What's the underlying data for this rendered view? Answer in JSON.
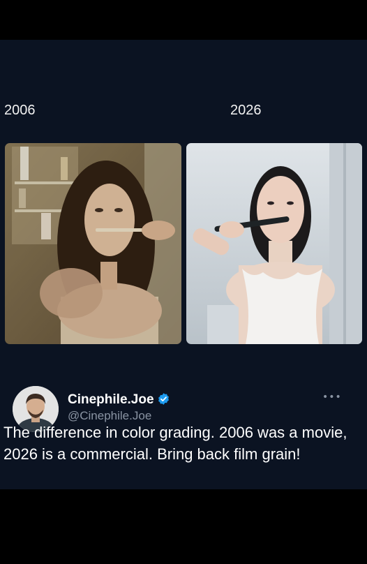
{
  "comparison": {
    "left_label": "2006",
    "right_label": "2026"
  },
  "author": {
    "display_name": "Cinephile.Joe",
    "handle": "@Cinephile.Joe",
    "verified": true
  },
  "more_label": "•••",
  "tweet": {
    "text": "The difference in color grading. 2006 was a movie, 2026 is a commercial. Bring back film grain!"
  },
  "colors": {
    "post_background": "#0b1322",
    "page_background": "#000000",
    "verified_badge": "#1d9bf0",
    "secondary_text": "#8a94a3"
  }
}
